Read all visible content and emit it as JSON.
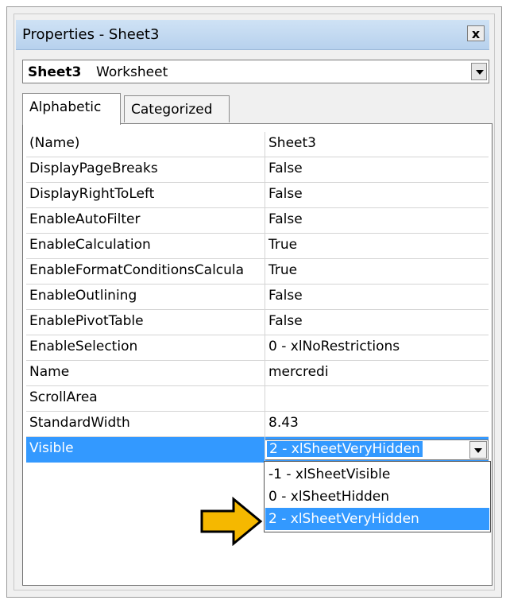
{
  "window": {
    "title": "Properties - Sheet3",
    "close_glyph": "x"
  },
  "object_selector": {
    "name": "Sheet3",
    "type": "Worksheet"
  },
  "tabs": [
    {
      "label": "Alphabetic",
      "active": true
    },
    {
      "label": "Categorized",
      "active": false
    }
  ],
  "properties": [
    {
      "name": "(Name)",
      "value": "Sheet3"
    },
    {
      "name": "DisplayPageBreaks",
      "value": "False"
    },
    {
      "name": "DisplayRightToLeft",
      "value": "False"
    },
    {
      "name": "EnableAutoFilter",
      "value": "False"
    },
    {
      "name": "EnableCalculation",
      "value": "True"
    },
    {
      "name": "EnableFormatConditionsCalcula",
      "value": "True"
    },
    {
      "name": "EnableOutlining",
      "value": "False"
    },
    {
      "name": "EnablePivotTable",
      "value": "False"
    },
    {
      "name": "EnableSelection",
      "value": "0 - xlNoRestrictions"
    },
    {
      "name": "Name",
      "value": "mercredi"
    },
    {
      "name": "ScrollArea",
      "value": ""
    },
    {
      "name": "StandardWidth",
      "value": "8.43"
    },
    {
      "name": "Visible",
      "value": "2 - xlSheetVeryHidden",
      "selected": true
    }
  ],
  "visible_dropdown": {
    "options": [
      "-1 - xlSheetVisible",
      "0 - xlSheetHidden",
      "2 - xlSheetVeryHidden"
    ],
    "highlighted_index": 2
  },
  "colors": {
    "selection": "#3399ff",
    "arrow_fill": "#f5b800"
  }
}
